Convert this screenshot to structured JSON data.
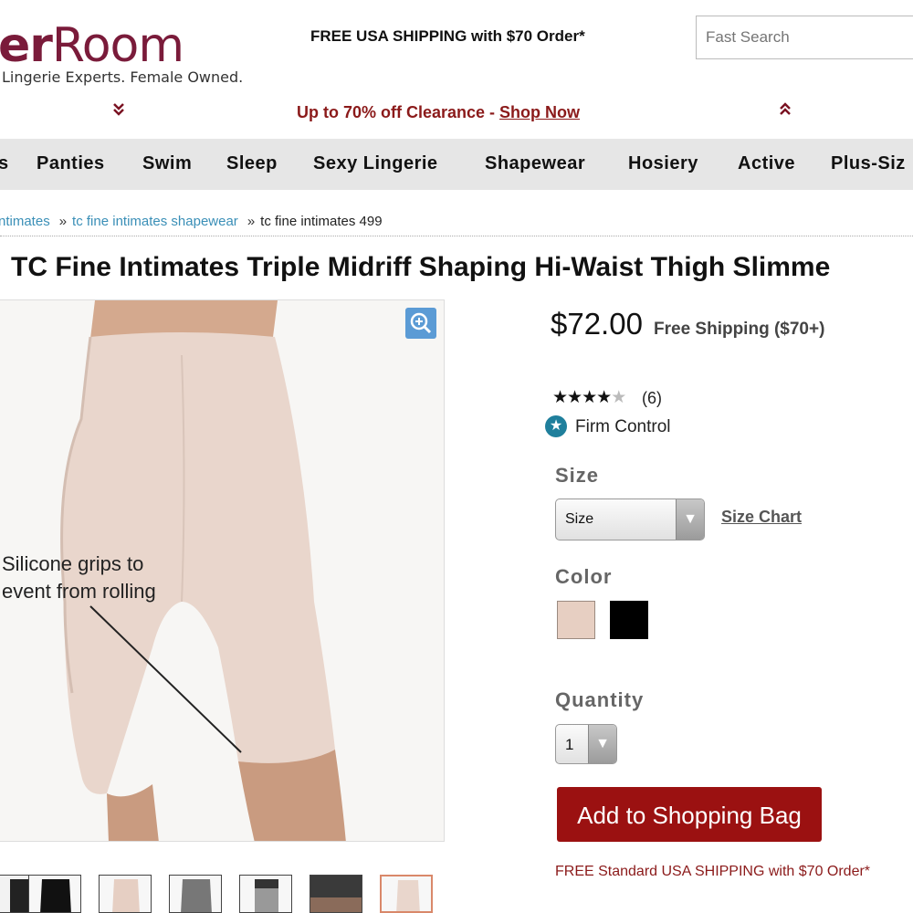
{
  "header": {
    "logo_bold": "er",
    "logo_light": "Room",
    "tagline": "Lingerie Experts. Female Owned.",
    "shipping_promo": "FREE USA SHIPPING with $70 Order*",
    "search_placeholder": "Fast Search"
  },
  "banner": {
    "left_icon": "chevron-double-down-icon",
    "text": "Up to 70% off Clearance - ",
    "link": "Shop Now",
    "right_icon": "chevron-double-up-icon"
  },
  "nav": {
    "items": [
      "s",
      "Panties",
      "Swim",
      "Sleep",
      "Sexy Lingerie",
      "Shapewear",
      "Hosiery",
      "Active",
      "Plus-Siz"
    ]
  },
  "breadcrumb": {
    "items": [
      "ntimates",
      "tc fine intimates shapewear",
      "tc fine intimates 499"
    ],
    "separator": "»"
  },
  "product": {
    "title": "TC Fine Intimates Triple Midriff Shaping Hi-Waist Thigh Slimme",
    "image_caption_line1": "Silicone grips to",
    "image_caption_line2": "event from rolling",
    "zoom_icon": "zoom-in-icon",
    "price": "$72.00",
    "free_shipping": "Free Shipping ($70+)",
    "rating": 4,
    "rating_max": 5,
    "review_count": "(6)",
    "control_level": "Firm Control",
    "size_label": "Size",
    "size_selected": "Size",
    "size_chart_link": "Size Chart",
    "color_label": "Color",
    "colors": [
      "#e7cfc2",
      "#000000"
    ],
    "quantity_label": "Quantity",
    "quantity_selected": "1",
    "add_button": "Add to Shopping Bag",
    "free_standard_shipping": "FREE Standard USA SHIPPING with $70 Order*"
  },
  "colors": {
    "brand": "#7a1b3a",
    "accent_red": "#9b1111",
    "link_blue": "#3a8fb7",
    "nav_bg": "#e6e6e6"
  }
}
